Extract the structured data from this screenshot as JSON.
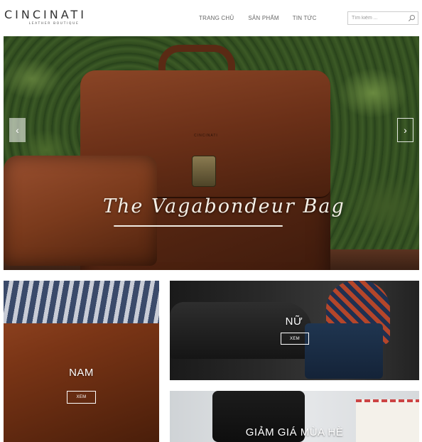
{
  "brand": {
    "name": "CINCINATI",
    "tagline": "LEATHER BOUTIQUE"
  },
  "nav": {
    "items": [
      {
        "label": "TRANG CHỦ"
      },
      {
        "label": "SẢN PHẨM"
      },
      {
        "label": "TIN TỨC"
      }
    ]
  },
  "search": {
    "placeholder": "Tìm kiếm ...",
    "icon": "search-icon"
  },
  "hero": {
    "title": "The Vagabondeur Bag",
    "bag_brand": "CINCINATI",
    "prev_icon": "chevron-left-icon",
    "next_icon": "chevron-right-icon",
    "prev_glyph": "‹",
    "next_glyph": "›"
  },
  "categories": [
    {
      "label": "NAM",
      "button": "XEM"
    },
    {
      "label": "NỮ",
      "button": "XEM"
    },
    {
      "label": "GIẢM GIÁ MÙA HÈ"
    }
  ]
}
